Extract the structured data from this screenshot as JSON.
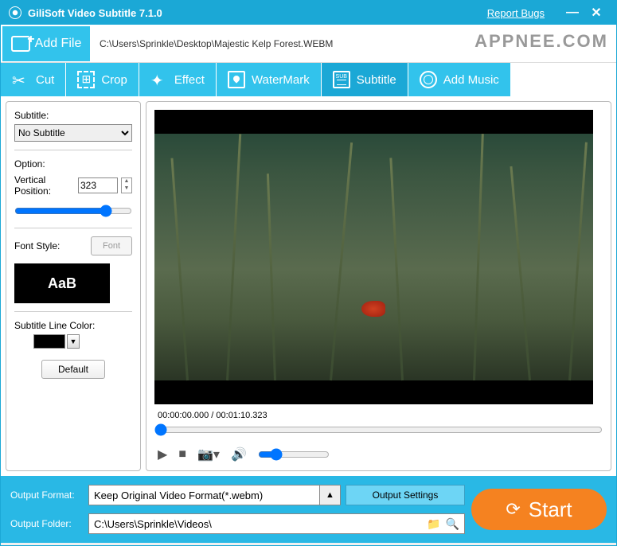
{
  "titlebar": {
    "title": "GiliSoft Video Subtitle 7.1.0",
    "report": "Report Bugs"
  },
  "addfile": {
    "label": "Add File",
    "path": "C:\\Users\\Sprinkle\\Desktop\\Majestic Kelp Forest.WEBM"
  },
  "watermark": "APPNEE.COM",
  "tabs": {
    "cut": "Cut",
    "crop": "Crop",
    "effect": "Effect",
    "watermark": "WaterMark",
    "subtitle": "Subtitle",
    "music": "Add Music"
  },
  "sidebar": {
    "subtitle_label": "Subtitle:",
    "subtitle_value": "No Subtitle",
    "option_label": "Option:",
    "vpos_label": "Vertical Position:",
    "vpos_value": "323",
    "fontstyle_label": "Font Style:",
    "font_button": "Font",
    "preview_text": "AaB",
    "linecolor_label": "Subtitle Line Color:",
    "default_button": "Default"
  },
  "preview": {
    "timecode": "00:00:00.000 / 00:01:10.323"
  },
  "footer": {
    "format_label": "Output Format:",
    "format_value": "Keep Original Video Format(*.webm)",
    "settings_button": "Output Settings",
    "folder_label": "Output Folder:",
    "folder_value": "C:\\Users\\Sprinkle\\Videos\\",
    "start_button": "Start"
  }
}
